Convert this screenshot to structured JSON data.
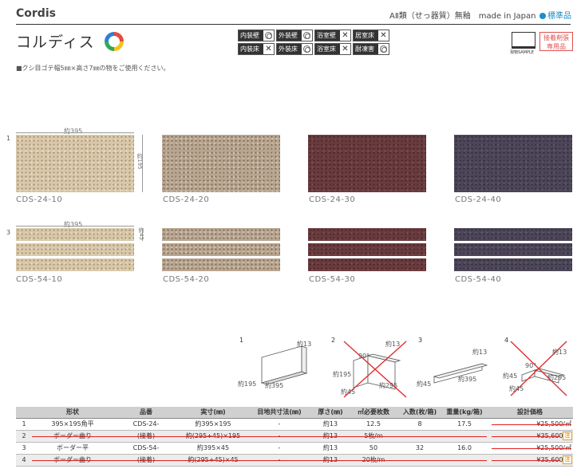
{
  "header": {
    "brand": "Cordis",
    "category": "AⅡ類（せっ器質）無釉　made in Japan",
    "standard": "標準品",
    "title": "コルディス",
    "sample_label": "現物SAMPLE",
    "adhesive": [
      "接着剤張",
      "専用品"
    ]
  },
  "usage": [
    {
      "label": "内装壁",
      "mark": "double-circle"
    },
    {
      "label": "外装壁",
      "mark": "double-circle"
    },
    {
      "label": "浴室壁",
      "mark": "cross"
    },
    {
      "label": "居室床",
      "mark": "cross"
    },
    {
      "label": "内装床",
      "mark": "cross"
    },
    {
      "label": "外装床",
      "mark": "double-circle"
    },
    {
      "label": "浴室床",
      "mark": "cross"
    },
    {
      "label": "耐凍害",
      "mark": "double-circle"
    }
  ],
  "note": "■クシ目ゴテ幅5㎜×高さ7㎜の物をご使用ください。",
  "row1": {
    "num": "1",
    "width_label": "約395",
    "height_label": "約195",
    "tiles": [
      {
        "code": "CDS-24-10",
        "color": "#d8c8a9"
      },
      {
        "code": "CDS-24-20",
        "color": "#b9a690"
      },
      {
        "code": "CDS-24-30",
        "color": "#6a3b3e"
      },
      {
        "code": "CDS-24-40",
        "color": "#4c4658"
      }
    ]
  },
  "row3": {
    "num": "3",
    "width_label": "約395",
    "height_label": "約45",
    "tiles": [
      {
        "code": "CDS-54-10",
        "color": "#d8c8a9"
      },
      {
        "code": "CDS-54-20",
        "color": "#b9a690"
      },
      {
        "code": "CDS-54-30",
        "color": "#6a3b3e"
      },
      {
        "code": "CDS-54-40",
        "color": "#4c4658"
      }
    ]
  },
  "diagrams": [
    {
      "num": "1",
      "labels": [
        "約13",
        "約195",
        "約395"
      ],
      "crossed": false
    },
    {
      "num": "2",
      "labels": [
        "約13",
        "90°",
        "約195",
        "約295",
        "約45"
      ],
      "crossed": true
    },
    {
      "num": "3",
      "labels": [
        "約13",
        "約395",
        "約45"
      ],
      "crossed": false
    },
    {
      "num": "4",
      "labels": [
        "約13",
        "90°",
        "約45",
        "約295",
        "約45"
      ],
      "crossed": true
    }
  ],
  "table": {
    "headers": [
      "",
      "形状",
      "品番",
      "実寸(㎜)",
      "目地共寸法(㎜)",
      "厚さ(㎜)",
      "㎡必要枚数",
      "入数(枚/箱)",
      "重量(kg/箱)",
      "設計価格"
    ],
    "rows": [
      {
        "cells": [
          "1",
          "395×195角平",
          "CDS-24-",
          "約395×195",
          "-",
          "約13",
          "12.5",
          "8",
          "17.5",
          "¥25,500/㎡"
        ],
        "cut": false,
        "price_cut": true
      },
      {
        "cells": [
          "2",
          "ボーダー曲り",
          "(接着)",
          "約(295+45)×195",
          "-",
          "約13",
          "5枚/m",
          "",
          "",
          "¥35,600/m"
        ],
        "cut": true,
        "price_cut": true
      },
      {
        "cells": [
          "3",
          "ボーダー平",
          "CDS-54-",
          "約395×45",
          "-",
          "約13",
          "50",
          "32",
          "16.0",
          "¥25,500/㎡"
        ],
        "cut": false,
        "price_cut": true
      },
      {
        "cells": [
          "4",
          "ボーダー曲り",
          "(接着)",
          "約(295+45)×45",
          "-",
          "約13",
          "20枚/m",
          "",
          "",
          "¥35,600/m"
        ],
        "cut": true,
        "price_cut": true
      }
    ],
    "note_badge": "注"
  },
  "colors": {
    "accent": "#1a8fc9",
    "strike": "#e02020"
  }
}
